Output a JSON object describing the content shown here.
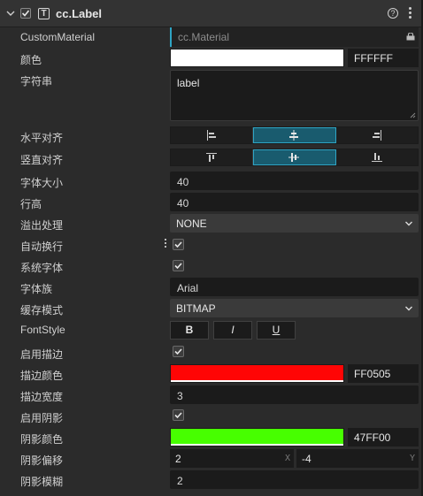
{
  "header": {
    "title": "cc.Label",
    "component_icon": "T"
  },
  "rows": {
    "custom_material": {
      "label": "CustomMaterial",
      "value": "cc.Material"
    },
    "color": {
      "label": "颜色",
      "hex": "FFFFFF",
      "swatch": "#ffffff"
    },
    "string": {
      "label": "字符串",
      "value": "label"
    },
    "h_align": {
      "label": "水平对齐",
      "selected_index": 1
    },
    "v_align": {
      "label": "竖直对齐",
      "selected_index": 1
    },
    "font_size": {
      "label": "字体大小",
      "value": "40"
    },
    "line_height": {
      "label": "行高",
      "value": "40"
    },
    "overflow": {
      "label": "溢出处理",
      "value": "NONE"
    },
    "wrap": {
      "label": "自动换行",
      "checked": true
    },
    "system_font": {
      "label": "系统字体",
      "checked": true
    },
    "font_family": {
      "label": "字体族",
      "value": "Arial"
    },
    "cache_mode": {
      "label": "缓存模式",
      "value": "BITMAP"
    },
    "font_style": {
      "label": "FontStyle",
      "bold": "B",
      "italic": "I",
      "underline": "U"
    },
    "outline_enabled": {
      "label": "启用描边",
      "checked": true
    },
    "outline_color": {
      "label": "描边颜色",
      "hex": "FF0505",
      "swatch": "#ff0505"
    },
    "outline_width": {
      "label": "描边宽度",
      "value": "3"
    },
    "shadow_enabled": {
      "label": "启用阴影",
      "checked": true
    },
    "shadow_color": {
      "label": "阴影颜色",
      "hex": "47FF00",
      "swatch": "#47ff00"
    },
    "shadow_offset": {
      "label": "阴影偏移",
      "x": "2",
      "y": "-4",
      "x_axis": "X",
      "y_axis": "Y"
    },
    "shadow_blur": {
      "label": "阴影模糊",
      "value": "2"
    }
  }
}
